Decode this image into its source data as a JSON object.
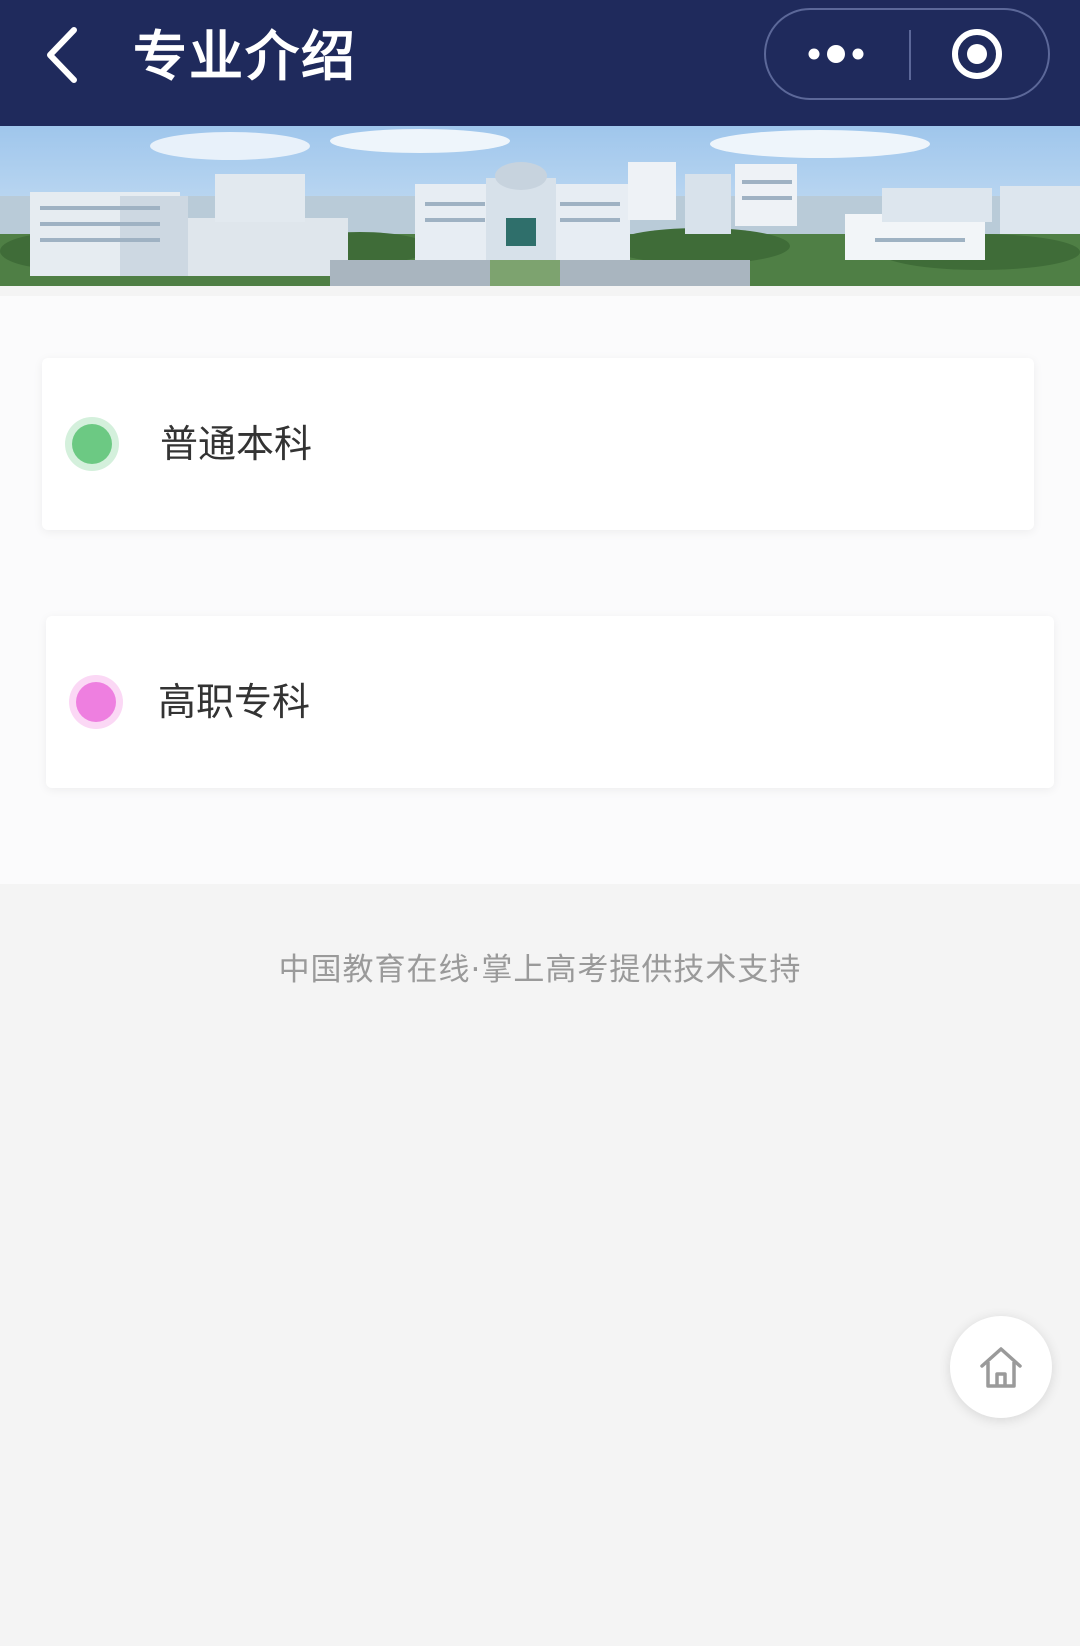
{
  "header": {
    "title": "专业介绍",
    "back_icon": "chevron-left-icon",
    "more_icon": "more-dots-icon",
    "close_icon": "target-circle-icon",
    "background": "#1f2a5c"
  },
  "banner": {
    "description_icon": "campus-banner-image"
  },
  "categories": [
    {
      "label": "普通本科",
      "dot_color": "#6cc983",
      "halo_color": "#d4f0dc"
    },
    {
      "label": "高职专科",
      "dot_color": "#ee7fe0",
      "halo_color": "#fbd8f5"
    }
  ],
  "footer": {
    "credit": "中国教育在线·掌上高考提供技术支持"
  },
  "fab": {
    "icon": "home-icon"
  }
}
